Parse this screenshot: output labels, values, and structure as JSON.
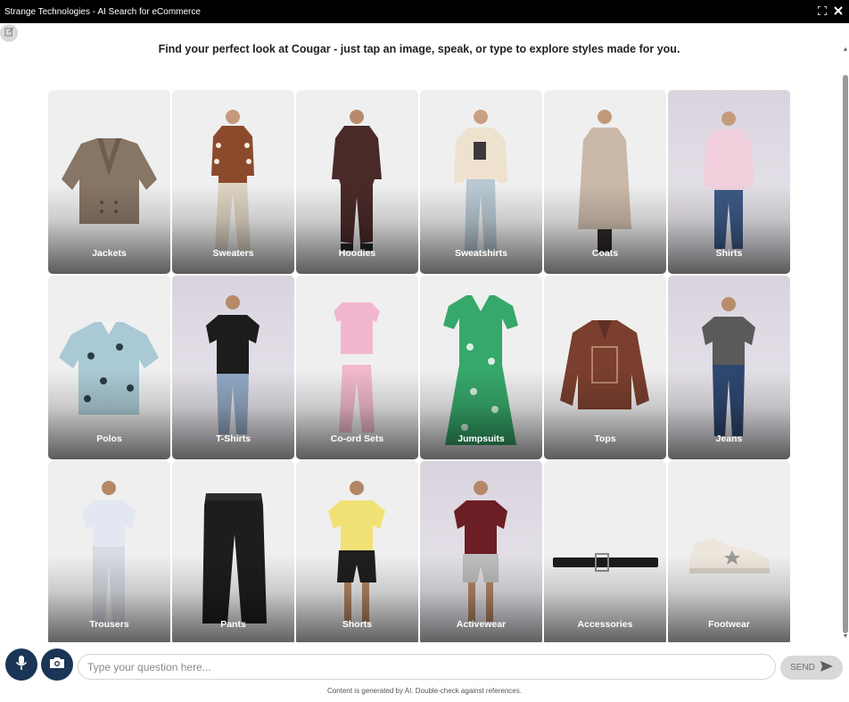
{
  "window": {
    "title": "Strange Technologies - AI Search for eCommerce",
    "expand_icon": "expand-icon",
    "close_icon": "close-icon"
  },
  "headline": "Find your perfect look at Cougar - just tap an image, speak, or type to explore styles made for you.",
  "categories": [
    {
      "label": "Jackets",
      "icon": "jacket-icon"
    },
    {
      "label": "Sweaters",
      "icon": "sweater-icon"
    },
    {
      "label": "Hoodies",
      "icon": "hoodie-icon"
    },
    {
      "label": "Sweatshirts",
      "icon": "sweatshirt-icon"
    },
    {
      "label": "Coats",
      "icon": "coat-icon"
    },
    {
      "label": "Shirts",
      "icon": "shirt-icon"
    },
    {
      "label": "Polos",
      "icon": "polo-icon"
    },
    {
      "label": "T-Shirts",
      "icon": "tshirt-icon"
    },
    {
      "label": "Co-ord Sets",
      "icon": "coord-set-icon"
    },
    {
      "label": "Jumpsuits",
      "icon": "jumpsuit-icon"
    },
    {
      "label": "Tops",
      "icon": "top-icon"
    },
    {
      "label": "Jeans",
      "icon": "jeans-icon"
    },
    {
      "label": "Trousers",
      "icon": "trousers-icon"
    },
    {
      "label": "Pants",
      "icon": "pants-icon"
    },
    {
      "label": "Shorts",
      "icon": "shorts-icon"
    },
    {
      "label": "Activewear",
      "icon": "activewear-icon"
    },
    {
      "label": "Accessories",
      "icon": "belt-icon"
    },
    {
      "label": "Footwear",
      "icon": "sneaker-icon"
    }
  ],
  "input": {
    "placeholder": "Type your question here...",
    "value": ""
  },
  "send_label": "SEND",
  "disclaimer": "Content is generated by AI. Double-check against references.",
  "colors": {
    "titlebar": "#000000",
    "action_button": "#1b3556",
    "send_button": "#d8d8d8"
  }
}
